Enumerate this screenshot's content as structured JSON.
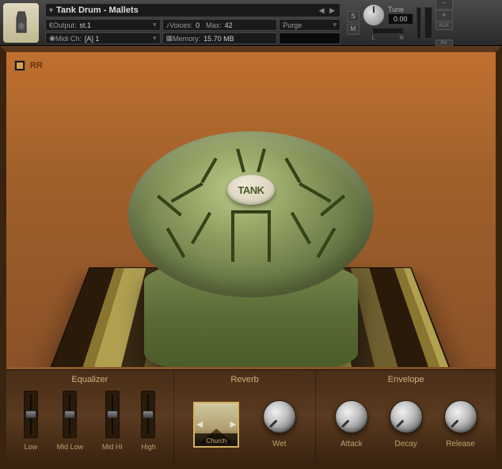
{
  "header": {
    "title": "Tank Drum - Mallets",
    "output_label": "Output:",
    "output_value": "st.1",
    "midi_label": "Midi Ch:",
    "midi_value": "[A] 1",
    "voices_label": "Voices:",
    "voices_value": "0",
    "max_label": "Max:",
    "max_value": "42",
    "purge_label": "Purge",
    "memory_label": "Memory:",
    "memory_value": "15.70 MB",
    "solo_btn": "S",
    "mute_btn": "M",
    "tune_label": "Tune",
    "tune_value": "0.00",
    "pan_left": "L",
    "pan_right": "R",
    "aux_btn": "AUX",
    "pv_btn": "PV",
    "minus_btn": "−",
    "close_btn": "×"
  },
  "instrument": {
    "rr_label": "RR",
    "drum_text": "TANK"
  },
  "controls": {
    "equalizer": {
      "title": "Equalizer",
      "bands": [
        "Low",
        "Mid Low",
        "Mid Hi",
        "High"
      ]
    },
    "reverb": {
      "title": "Reverb",
      "preset": "Church",
      "wet_label": "Wet"
    },
    "envelope": {
      "title": "Envelope",
      "params": [
        "Attack",
        "Decay",
        "Release"
      ]
    }
  }
}
